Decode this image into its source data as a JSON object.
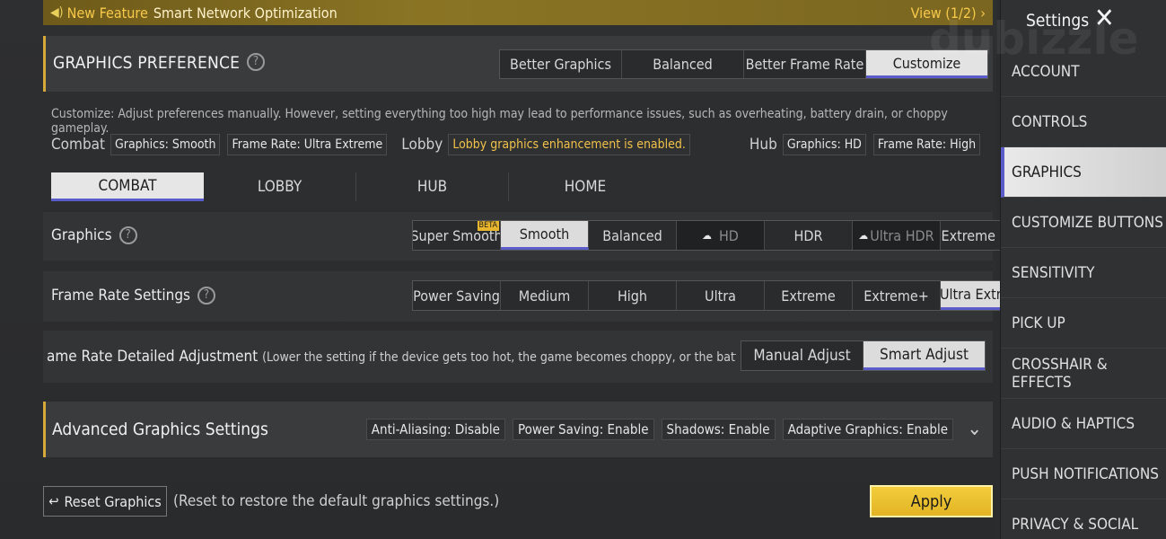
{
  "banner": {
    "new_feature": "New Feature",
    "title": "Smart Network Optimization",
    "view": "View (1/2) ›"
  },
  "preference": {
    "title": "GRAPHICS PREFERENCE",
    "options": [
      "Better Graphics",
      "Balanced",
      "Better Frame Rate",
      "Customize"
    ],
    "selected_index": 3,
    "description": "Customize: Adjust preferences manually. However, setting everything too high may lead to performance issues, such as overheating, battery drain, or choppy gameplay."
  },
  "summary": {
    "combat_label": "Combat",
    "combat_chips": [
      "Graphics: Smooth",
      "Frame Rate: Ultra Extreme"
    ],
    "lobby_label": "Lobby",
    "lobby_chip": "Lobby graphics enhancement is enabled.",
    "hub_label": "Hub",
    "hub_chips": [
      "Graphics: HD",
      "Frame Rate: High"
    ]
  },
  "tabs": [
    "COMBAT",
    "LOBBY",
    "HUB",
    "HOME"
  ],
  "graphics": {
    "label": "Graphics",
    "options": [
      "Super Smooth",
      "Smooth",
      "Balanced",
      "HD",
      "HDR",
      "Ultra HDR",
      "Extreme HDR"
    ],
    "beta": "BETA",
    "selected_index": 1
  },
  "frame_rate": {
    "label": "Frame Rate Settings",
    "options": [
      "Power Saving",
      "Medium",
      "High",
      "Ultra",
      "Extreme",
      "Extreme+",
      "Ultra Extreme"
    ],
    "selected_index": 6
  },
  "detailed": {
    "label": "ame Rate Detailed Adjustment",
    "note": "(Lower the setting if the device gets too hot, the game becomes choppy, or the battery drains too",
    "options": [
      "Manual Adjust",
      "Smart Adjust"
    ],
    "selected_index": 1
  },
  "advanced": {
    "title": "Advanced Graphics Settings",
    "chips": [
      "Anti-Aliasing: Disable",
      "Power Saving: Enable",
      "Shadows: Enable",
      "Adaptive Graphics: Enable"
    ]
  },
  "footer": {
    "reset_label": "Reset Graphics",
    "reset_note": "(Reset to restore the default graphics settings.)",
    "apply_label": "Apply"
  },
  "sidebar": {
    "title": "Settings",
    "watermark": "dubizzle",
    "items": [
      "ACCOUNT",
      "CONTROLS",
      "GRAPHICS",
      "CUSTOMIZE BUTTONS",
      "SENSITIVITY",
      "PICK UP",
      "CROSSHAIR & EFFECTS",
      "AUDIO & HAPTICS",
      "PUSH NOTIFICATIONS",
      "PRIVACY & SOCIAL"
    ],
    "selected_index": 2
  },
  "colors": {
    "accent": "#5a5cc9",
    "gold": "#d4a93a",
    "apply": "#f2cd3c",
    "warning_text": "#f0c14a"
  }
}
